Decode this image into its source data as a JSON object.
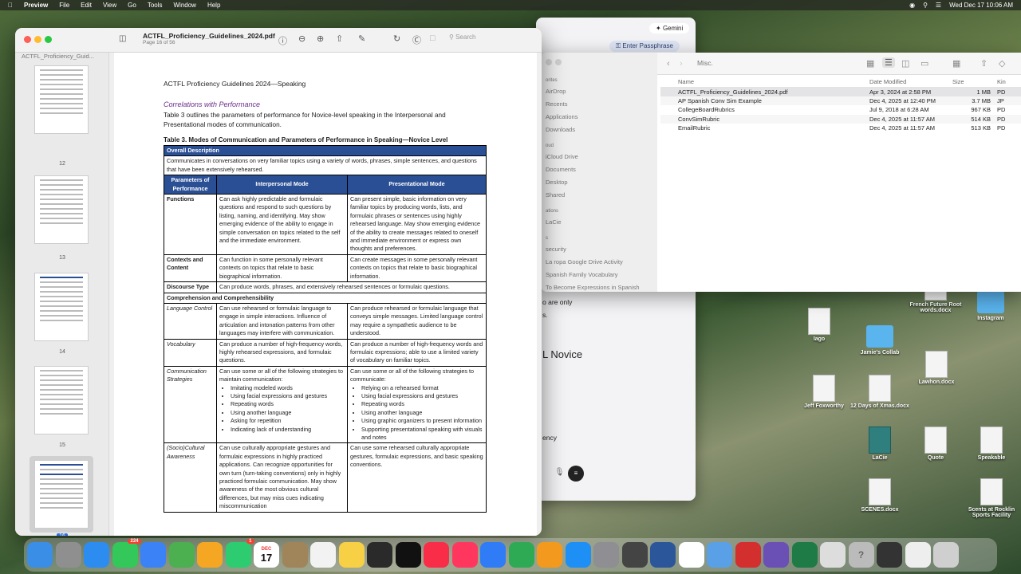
{
  "menubar": {
    "app": "Preview",
    "items": [
      "File",
      "Edit",
      "View",
      "Go",
      "Tools",
      "Window",
      "Help"
    ],
    "datetime": "Wed Dec 17  10:06 AM"
  },
  "desktop_icons": [
    {
      "label": "French Future Root words.docx",
      "kind": "doc"
    },
    {
      "label": "Instagram",
      "kind": "folder"
    },
    {
      "label": "Iago",
      "kind": "doc"
    },
    {
      "label": "Jamie's Collab",
      "kind": "folder"
    },
    {
      "label": "Lawhon.docx",
      "kind": "doc"
    },
    {
      "label": "Jeff Foxworthy",
      "kind": "doc"
    },
    {
      "label": "12 Days of Xmas.docx",
      "kind": "doc"
    },
    {
      "label": "LaCie",
      "kind": "drive"
    },
    {
      "label": "Quote",
      "kind": "doc"
    },
    {
      "label": "Speakable",
      "kind": "doc"
    },
    {
      "label": "SCENES.docx",
      "kind": "doc"
    },
    {
      "label": "Scents at Rocklin Sports Facility",
      "kind": "doc"
    }
  ],
  "browser": {
    "gemini_label": "Gemini",
    "passphrase_label": "Enter Passphrase",
    "snippet1": "o are only",
    "snippet2": "s.",
    "heading": "L Novice",
    "snippet3": "ency"
  },
  "finder": {
    "folder": "Misc.",
    "sidebar": [
      "orites",
      "AirDrop",
      "Recents",
      "Applications",
      "Downloads",
      "oud",
      "iCloud Drive",
      "Documents",
      "Desktop",
      "Shared",
      "ations",
      "LaCie",
      "s",
      "security",
      "La ropa Google Drive Activity",
      "Spanish Family Vocabulary",
      "To Become Expressions in Spanish"
    ],
    "columns": [
      "Name",
      "Date Modified",
      "Size",
      "Kin"
    ],
    "files": [
      {
        "name": "ACTFL_Proficiency_Guidelines_2024.pdf",
        "date": "Apr 3, 2024 at 2:58 PM",
        "size": "1 MB",
        "kind": "PD"
      },
      {
        "name": "AP Spanish Conv Sim Example",
        "date": "Dec 4, 2025 at 12:40 PM",
        "size": "3.7 MB",
        "kind": "JP"
      },
      {
        "name": "CollegeBoardRubrics",
        "date": "Jul 9, 2018 at 6:28 AM",
        "size": "967 KB",
        "kind": "PD"
      },
      {
        "name": "ConvSimRubric",
        "date": "Dec 4, 2025 at 11:57 AM",
        "size": "514 KB",
        "kind": "PD"
      },
      {
        "name": "EmailRubric",
        "date": "Dec 4, 2025 at 11:57 AM",
        "size": "513 KB",
        "kind": "PD"
      }
    ]
  },
  "preview": {
    "sidebar_title": "ACTFL_Proficiency_Guid...",
    "doc_title": "ACTFL_Proficiency_Guidelines_2024.pdf",
    "page_info": "Page 16 of 56",
    "search_placeholder": "Search",
    "thumb_pages": [
      "12",
      "13",
      "14",
      "15",
      "16"
    ],
    "page": {
      "header": "ACTFL Proficiency Guidelines 2024—Speaking",
      "section": "Correlations with Performance",
      "intro": "Table 3 outlines the parameters of performance for Novice-level speaking in the Interpersonal and Presentational modes of communication.",
      "table_caption": "Table 3. Modes of Communication and Parameters of Performance in Speaking—Novice Level",
      "overall_head": "Overall Description",
      "overall_text": "Communicates in conversations on very familiar topics using a variety of words, phrases, simple sentences, and questions that have been extensively rehearsed.",
      "col_params": "Parameters of Performance",
      "col_inter": "Interpersonal Mode",
      "col_pres": "Presentational Mode",
      "functions_label": "Functions",
      "functions_inter": "Can ask highly predictable and formulaic questions and respond to such questions by listing, naming, and identifying. May show emerging evidence of the ability to engage in simple conversation on topics related to the self and the immediate environment.",
      "functions_pres": "Can present simple, basic information on very familiar topics by producing words, lists, and formulaic phrases or sentences using highly rehearsed language. May show emerging evidence of the ability to create messages related to oneself and immediate environment or express own thoughts and preferences.",
      "contexts_label": "Contexts and Content",
      "contexts_inter": "Can function in some personally relevant contexts on topics that relate to basic biographical information.",
      "contexts_pres": "Can create messages in some personally relevant contexts on topics that relate to basic biographical information.",
      "discourse_label": "Discourse Type",
      "discourse_text": "Can produce words, phrases, and extensively rehearsed sentences or formulaic questions.",
      "comp_head": "Comprehension and Comprehensibility",
      "lang_label": "Language Control",
      "lang_inter": "Can use rehearsed or formulaic language to engage in simple interactions. Influence of articulation and intonation patterns from other languages may interfere with communication.",
      "lang_pres": "Can produce rehearsed or formulaic language that conveys simple messages. Limited language control may require a sympathetic audience to be understood.",
      "vocab_label": "Vocabulary",
      "vocab_inter": "Can produce a number of high-frequency words, highly rehearsed expressions, and formulaic questions.",
      "vocab_pres": "Can produce a number of high-frequency words and formulaic expressions; able to use a limited variety of vocabulary on familiar topics.",
      "comm_label": "Communication Strategies",
      "comm_inter_intro": "Can use some or all of the following strategies to maintain communication:",
      "comm_inter_list": [
        "Imitating modeled words",
        "Using facial expressions and gestures",
        "Repeating words",
        "Using another language",
        "Asking for repetition",
        "Indicating lack of understanding"
      ],
      "comm_pres_intro": "Can use some or all of the following strategies to communicate:",
      "comm_pres_list": [
        "Relying on a rehearsed format",
        "Using facial expressions and gestures",
        "Repeating words",
        "Using another language",
        "Using graphic organizers to present information",
        "Supporting presentational speaking with visuals and notes"
      ],
      "socio_label": "(Socio)Cultural Awareness",
      "socio_inter": "Can use culturally appropriate gestures and formulaic expressions in highly practiced applications. Can recognize opportunities for own turn (turn-taking conventions) only in highly practiced formulaic communication. May show awareness of the most obvious cultural differences, but may miss cues indicating miscommunication",
      "socio_pres": "Can use some rehearsed culturally appropriate gestures, formulaic expressions, and basic speaking conventions."
    }
  },
  "dock": {
    "messages_badge": "224",
    "facetime_badge": "1",
    "calendar_month": "DEC",
    "calendar_day": "17",
    "apps": [
      "finder-icon",
      "launchpad-icon",
      "safari-icon",
      "messages-icon",
      "mail-icon",
      "maps-icon",
      "photos-icon",
      "facetime-icon",
      "calendar-icon",
      "contacts-icon",
      "reminders-icon",
      "notes-icon",
      "freeform-icon",
      "tv-icon",
      "music-icon",
      "news-icon",
      "keynote-icon",
      "numbers-icon",
      "pages-icon",
      "app-store-icon",
      "system-settings-icon",
      "iphone-mirroring-icon",
      "word-icon",
      "chrome-icon",
      "preview-icon",
      "acrobat-icon",
      "imovie-icon",
      "excel-icon",
      "file-icon",
      "help-icon",
      "screenshot-icon",
      "document-icon",
      "trash-icon"
    ]
  }
}
